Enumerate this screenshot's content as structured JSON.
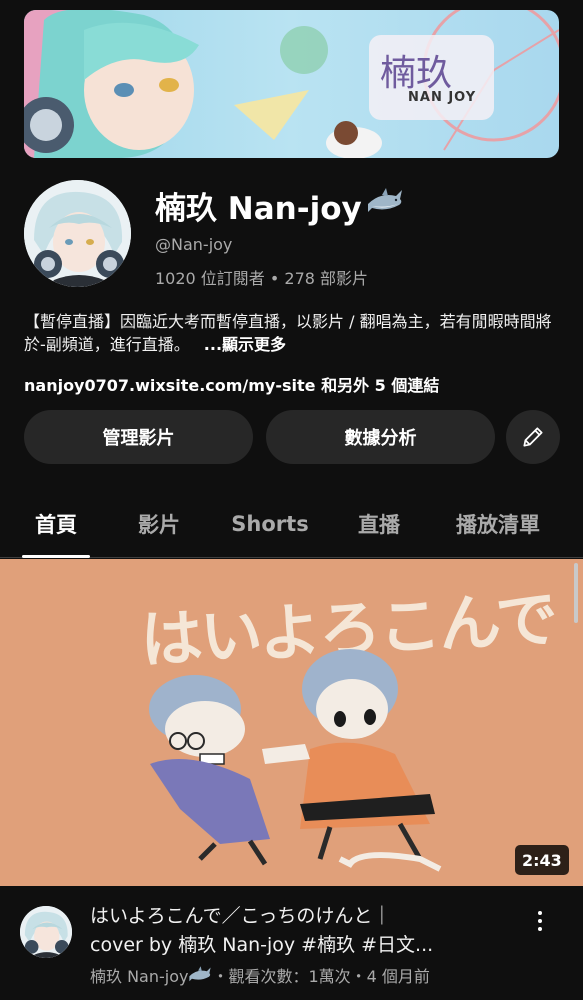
{
  "channel": {
    "name": "楠玖 Nan-joy",
    "handle": "@Nan-joy",
    "stats": "1020 位訂閱者 • 278 部影片",
    "description": "【暫停直播】因臨近大考而暫停直播，以影片 / 翻唱為主，若有閒暇時間將於-副頻道，進行直播。",
    "more_label": "...顯示更多",
    "links_text": "nanjoy0707.wixsite.com/my-site 和另外 5 個連結",
    "banner_logo_text": "楠玖",
    "banner_logo_sub": "NAN JOY"
  },
  "actions": {
    "manage_label": "管理影片",
    "analytics_label": "數據分析",
    "edit_icon": "pencil-icon"
  },
  "tabs": [
    {
      "label": "首頁",
      "active": true
    },
    {
      "label": "影片",
      "active": false
    },
    {
      "label": "Shorts",
      "active": false
    },
    {
      "label": "直播",
      "active": false
    },
    {
      "label": "播放清單",
      "active": false
    }
  ],
  "video": {
    "thumbnail_title": "はいよろこんで",
    "duration": "2:43",
    "title_line1": "はいよろこんで／こっちのけんと｜",
    "title_line2": "cover by 楠玖 Nan-joy #楠玖 #日文...",
    "meta_channel": "楠玖 Nan-joy",
    "meta_rest": "・觀看次數：1萬次・4 個月前"
  },
  "colors": {
    "background": "#0f0f0f",
    "button_bg": "#272727",
    "secondary_text": "#aaaaaa",
    "thumbnail_bg": "#e0a07a"
  }
}
